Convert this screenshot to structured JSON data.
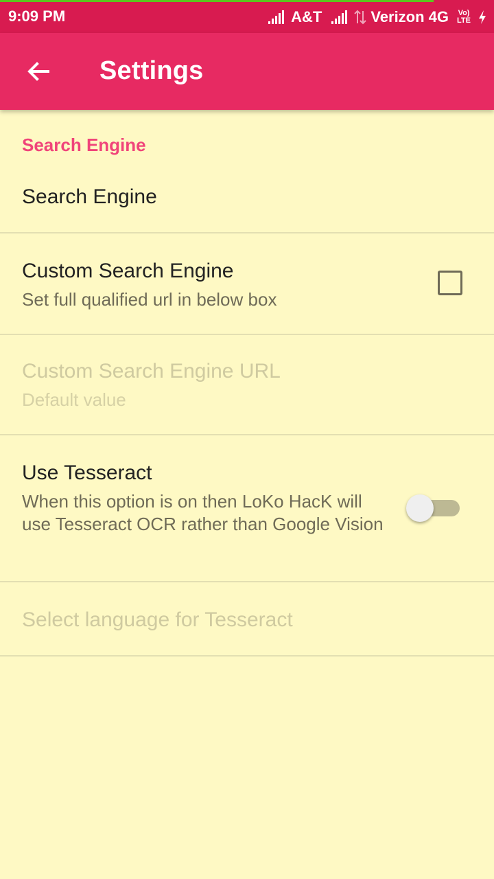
{
  "status_bar": {
    "time": "9:09 PM",
    "carrier1": "A&T",
    "carrier2": "Verizon 4G",
    "volte_line1": "Vo)",
    "volte_line2": "LTE"
  },
  "app_bar": {
    "title": "Settings",
    "back_icon": "arrow-back-icon"
  },
  "category": {
    "label": "Search Engine"
  },
  "preferences": {
    "search_engine": {
      "title": "Search Engine"
    },
    "custom_search_engine": {
      "title": "Custom Search Engine",
      "summary": "Set full qualified url in below box",
      "checked": false
    },
    "custom_search_engine_url": {
      "title": "Custom Search Engine URL",
      "summary": "Default value",
      "enabled": false
    },
    "use_tesseract": {
      "title": "Use Tesseract",
      "summary": "When this option is on then LoKo HacK will use Tesseract OCR rather than Google Vision",
      "on": false
    },
    "tesseract_language": {
      "title": "Select language for Tesseract",
      "enabled": false
    }
  },
  "colors": {
    "status_bar": "#d81b50",
    "app_bar": "#e72a62",
    "accent": "#f0447a",
    "background": "#fef9c4"
  }
}
